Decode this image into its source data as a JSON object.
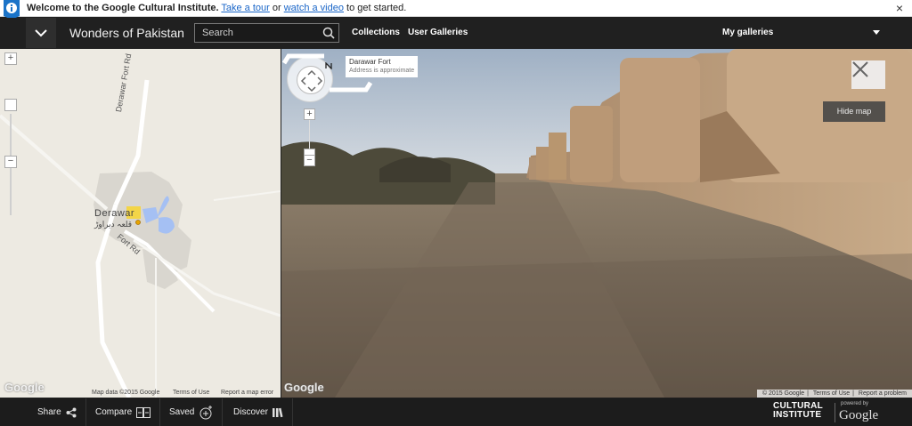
{
  "infobar": {
    "welcome": "Welcome to the Google Cultural Institute.",
    "tour_link": "Take a tour",
    "or": "or",
    "video_link": "watch a video",
    "tail": "to get started.",
    "close": "×"
  },
  "header": {
    "title": "Wonders of Pakistan",
    "search_placeholder": "Search",
    "collections": "Collections",
    "user_galleries": "User Galleries",
    "my_galleries": "My galleries"
  },
  "map": {
    "road_label_1": "Derawar Fort Rd",
    "road_label_2": "Fort Rd",
    "town": "Derawar",
    "town_urdu": "قلعہ دیراوڑ",
    "zoom_in": "+",
    "zoom_out": "−",
    "logo": "Google",
    "map_data": "Map data ©2015 Google",
    "terms": "Terms of Use",
    "report": "Report a map error"
  },
  "streetview": {
    "place_name": "Darawar Fort",
    "place_sub": "Address is approximate",
    "zoom_in": "+",
    "zoom_out": "−",
    "hide_map": "Hide map",
    "logo": "Google",
    "copyright": "© 2015 Google",
    "terms": "Terms of Use",
    "report": "Report a problem"
  },
  "bottombar": {
    "share": "Share",
    "compare": "Compare",
    "saved": "Saved",
    "discover": "Discover",
    "ci_line1": "CULTURAL",
    "ci_line2": "INSTITUTE",
    "powered_by": "powered by",
    "google": "Google"
  },
  "colors": {
    "header_bg": "#202020",
    "link_blue": "#1a66c8",
    "info_blue": "#1a73c8"
  }
}
